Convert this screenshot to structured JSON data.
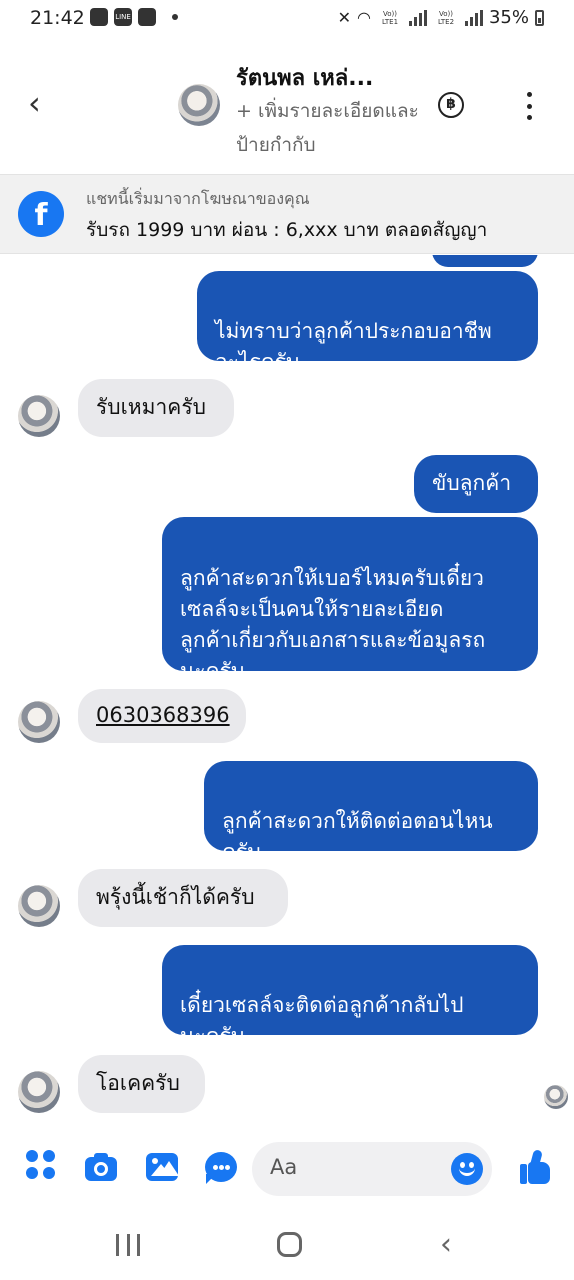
{
  "status_bar": {
    "time": "21:42",
    "battery": "35%",
    "net1": "Vo)) LTE1",
    "net2": "Vo)) LTE2",
    "line_icon": "LINE"
  },
  "header": {
    "contact_name": "รัตนพล เหล่...",
    "subtitle": "+ เพิ่มรายละเอียดและป้ายกำกับ",
    "coin_symbol": "฿",
    "icons": [
      "back-arrow-icon",
      "baht-coin-icon",
      "more-vert-icon"
    ]
  },
  "ad_banner": {
    "line1": "แชทนี้เริ่มมาจากโฆษณาของคุณ",
    "line2": "รับรถ 1999 บาท ผ่อน : 6,xxx บาท ตลอดสัญญา",
    "icon_letter": "f"
  },
  "messages": [
    {
      "side": "out",
      "text": "ไม่ทราบว่าลูกค้าประกอบอาชีพ\nอะไรครับ"
    },
    {
      "side": "in",
      "text": "รับเหมาครับ"
    },
    {
      "side": "out",
      "text": "ขับลูกค้า"
    },
    {
      "side": "out",
      "text": "ลูกค้าสะดวกให้เบอร์ไหมครับเดี๋ยว\nเซลล์จะเป็นคนให้รายละเอียด\nลูกค้าเกี่ยวกับเอกสารและข้อมูลรถ\nนะครับ"
    },
    {
      "side": "in",
      "text": "0630368396"
    },
    {
      "side": "out",
      "text": "ลูกค้าสะดวกให้ติดต่อตอนไหน\nครับ"
    },
    {
      "side": "in",
      "text": "พรุ้งนี้เช้าก็ได้ครับ"
    },
    {
      "side": "out",
      "text": "เดี๋ยวเซลล์จะติดต่อลูกค้ากลับไป\nนะครับ"
    },
    {
      "side": "in",
      "text": "โอเคครับ"
    }
  ],
  "composer": {
    "placeholder": "Aa"
  },
  "colors": {
    "outgoing_bubble": "#1a55b4",
    "incoming_bubble": "#e9e9ec",
    "accent": "#1877f2"
  }
}
